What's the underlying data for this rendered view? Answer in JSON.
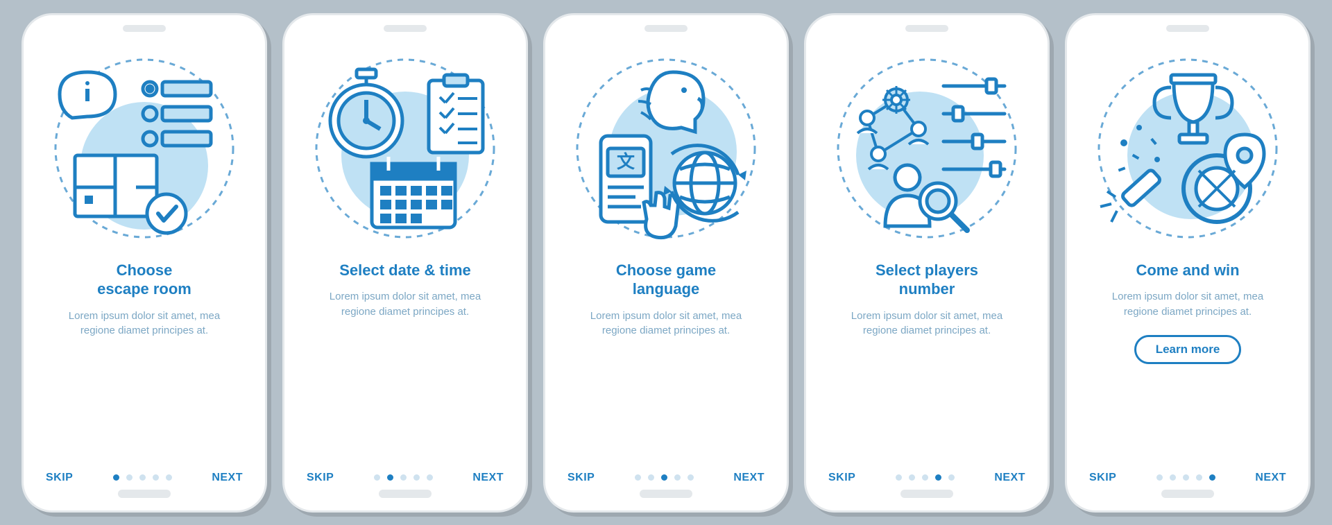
{
  "common": {
    "skip": "SKIP",
    "next": "NEXT",
    "body": "Lorem ipsum dolor sit amet, mea regione diamet principes at."
  },
  "screens": [
    {
      "title": "Choose\nescape room",
      "icon": "escape-room-icon",
      "active": 0,
      "cta": null
    },
    {
      "title": "Select date & time",
      "icon": "date-time-icon",
      "active": 1,
      "cta": null
    },
    {
      "title": "Choose game\nlanguage",
      "icon": "language-icon",
      "active": 2,
      "cta": null
    },
    {
      "title": "Select players\nnumber",
      "icon": "players-icon",
      "active": 3,
      "cta": null
    },
    {
      "title": "Come and win",
      "icon": "trophy-icon",
      "active": 4,
      "cta": "Learn more"
    }
  ]
}
